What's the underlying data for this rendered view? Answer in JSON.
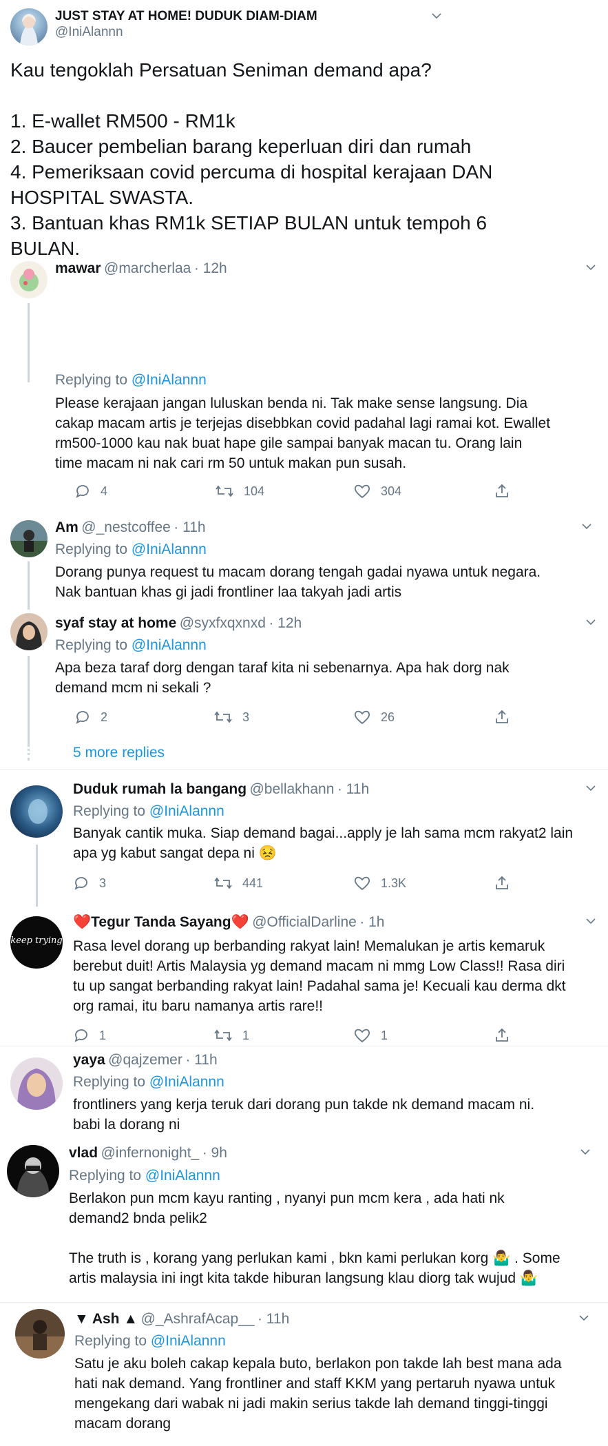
{
  "main": {
    "name": "JUST STAY AT HOME! DUDUK DIAM-DIAM",
    "handle": "@IniAlannn",
    "lines": [
      "Kau tengoklah Persatuan Seniman demand apa?",
      "",
      "1. E-wallet RM500 - RM1k",
      "2. Baucer pembelian barang keperluan diri dan rumah",
      "4. Pemeriksaan covid percuma di hospital kerajaan DAN",
      "HOSPITAL SWASTA.",
      "3. Bantuan khas RM1k SETIAP BULAN untuk tempoh 6",
      "BULAN."
    ]
  },
  "replying_label": "Replying to",
  "replying_handle": "@IniAlannn",
  "more_replies": "5 more replies",
  "replies": [
    {
      "name": "mawar",
      "handle": "@marcherlaa",
      "time": "· 12h",
      "lines": [
        "Please kerajaan jangan luluskan benda ni. Tak make sense langsung. Dia",
        "cakap macam artis je terjejas disebbkan covid padahal lagi ramai kot. Ewallet",
        "rm500-1000 kau nak buat hape gile sampai banyak macan tu. Orang lain",
        "time macam ni nak cari rm 50 untuk makan pun susah."
      ],
      "replies": "4",
      "retweets": "104",
      "likes": "304"
    },
    {
      "name": "Am",
      "handle": "@_nestcoffee",
      "time": "· 11h",
      "lines": [
        "Dorang punya request tu macam dorang tengah gadai nyawa untuk negara.",
        "Nak bantuan khas gi jadi frontliner laa takyah jadi artis"
      ]
    },
    {
      "name": "syaf stay at home",
      "handle": "@syxfxqxnxd",
      "time": "· 12h",
      "lines": [
        "Apa beza taraf dorg dengan taraf kita ni sebenarnya. Apa hak dorg nak",
        "demand mcm ni sekali ?"
      ],
      "replies": "2",
      "retweets": "3",
      "likes": "26"
    },
    {
      "name": "Duduk rumah la bangang",
      "handle": "@bellakhann",
      "time": "· 11h",
      "lines": [
        "Banyak cantik muka. Siap demand bagai...apply je lah sama mcm rakyat2 lain",
        "apa yg kabut sangat depa ni 😣"
      ],
      "replies": "3",
      "retweets": "441",
      "likes": "1.3K"
    },
    {
      "name": "❤️Tegur Tanda Sayang❤️",
      "handle": "@OfficialDarline",
      "time": "· 1h",
      "avatar_text": "keep trying",
      "lines": [
        "Rasa level dorang up berbanding rakyat lain! Memalukan je artis kemaruk",
        "berebut duit! Artis Malaysia yg demand macam ni mmg Low Class!! Rasa diri",
        "tu up sangat berbanding rakyat lain! Padahal sama je! Kecuali kau derma dkt",
        "org ramai, itu baru namanya artis rare!!"
      ],
      "replies": "1",
      "retweets": "1",
      "likes": "1"
    },
    {
      "name": "yaya",
      "handle": "@qajzemer",
      "time": "· 11h",
      "lines": [
        "frontliners yang kerja teruk dari dorang pun takde nk demand macam ni.",
        "babi la dorang ni"
      ]
    },
    {
      "name": "vlad",
      "handle": "@infernonight_",
      "time": "· 9h",
      "lines": [
        "Berlakon pun mcm kayu ranting , nyanyi pun mcm kera , ada hati nk",
        "demand2 bnda pelik2",
        "",
        "The truth is , korang yang perlukan kami , bkn kami perlukan korg 🤷‍♂️ . Some",
        "artis malaysia ini ingt kita takde hiburan langsung klau diorg tak wujud 🤷‍♂️"
      ]
    },
    {
      "name": "▼ Ash ▲",
      "handle": "@_AshrafAcap__",
      "time": "· 11h",
      "lines": [
        "Satu je aku boleh cakap kepala buto, berlakon pon takde lah best mana ada",
        "hati nak demand. Yang frontliner and staff KKM yang pertaruh nyawa untuk",
        "mengekang dari wabak ni jadi makin serius takde lah demand tinggi-tinggi",
        "macam dorang"
      ]
    }
  ],
  "colors": {
    "link": "#1b95e0",
    "muted": "#657786",
    "text": "#14171a",
    "thread": "#ccd6dd"
  },
  "icons": [
    "reply-icon",
    "retweet-icon",
    "like-icon",
    "share-icon",
    "chevron-down-icon"
  ]
}
